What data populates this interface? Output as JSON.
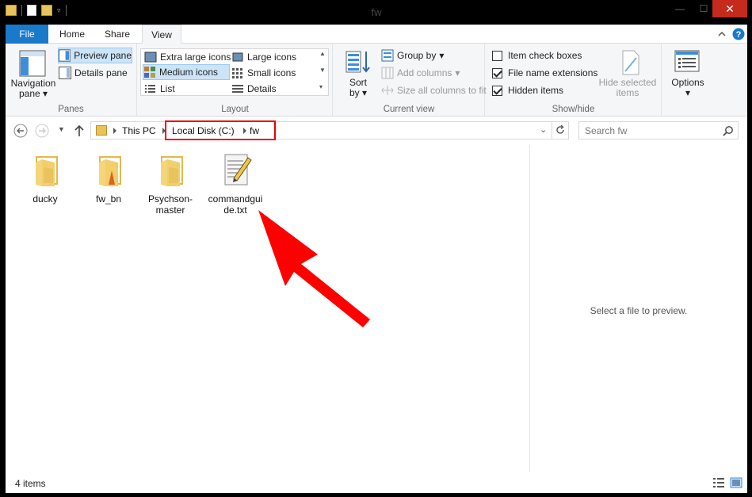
{
  "window": {
    "title": "fw"
  },
  "tabs": [
    {
      "label": "File"
    },
    {
      "label": "Home"
    },
    {
      "label": "Share"
    },
    {
      "label": "View"
    }
  ],
  "ribbon": {
    "panes": {
      "navigation_pane": "Navigation pane",
      "preview_pane": "Preview pane",
      "details_pane": "Details pane",
      "group_label": "Panes"
    },
    "layout": {
      "options": [
        "Extra large icons",
        "Large icons",
        "Medium icons",
        "Small icons",
        "List",
        "Details"
      ],
      "selected": "Medium icons",
      "group_label": "Layout"
    },
    "current_view": {
      "sort_by": "Sort by",
      "group_by": "Group by",
      "add_columns": "Add columns",
      "size_all_columns": "Size all columns to fit",
      "group_label": "Current view"
    },
    "show_hide": {
      "item_check_boxes": {
        "label": "Item check boxes",
        "checked": false
      },
      "file_name_extensions": {
        "label": "File name extensions",
        "checked": true
      },
      "hidden_items": {
        "label": "Hidden items",
        "checked": true
      },
      "hide_selected_items": "Hide selected items",
      "group_label": "Show/hide"
    },
    "options": {
      "label": "Options"
    }
  },
  "address": {
    "crumbs": [
      "This PC",
      "Local Disk (C:)",
      "fw"
    ],
    "highlight_color": "#e00000"
  },
  "search": {
    "placeholder": "Search fw"
  },
  "files": [
    {
      "name": "ducky",
      "type": "folder"
    },
    {
      "name": "fw_bn",
      "type": "folder"
    },
    {
      "name": "Psychson-master",
      "type": "folder"
    },
    {
      "name": "commandguide.txt",
      "type": "text-file"
    }
  ],
  "preview": {
    "message": "Select a file to preview."
  },
  "status": {
    "count": "4 items"
  },
  "colors": {
    "accent": "#1979ca",
    "arrow": "#ff0000",
    "folder": "#f2cf6b"
  }
}
